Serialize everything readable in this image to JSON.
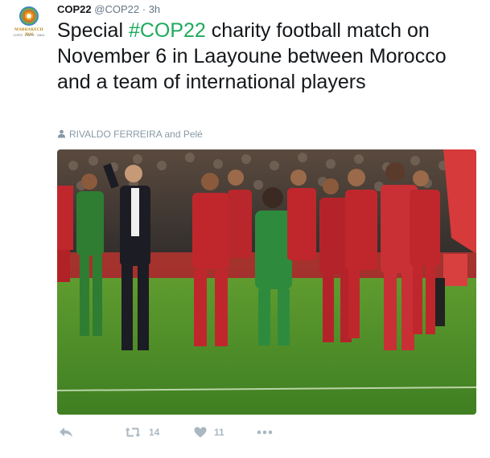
{
  "tweet": {
    "account_name": "COP22",
    "handle": "@COP22",
    "separator": "·",
    "time": "3h",
    "text_before": "Special ",
    "hashtag": "#COP22",
    "text_after": " charity football match on November 6 in Laayoune between Morocco and a team of international players",
    "tagged_people": "RIVALDO FERREIRA and Pelé",
    "avatar_logo_text": "MARRAKECH 2016",
    "avatar_logo_subtext": "COP22 · CMP12 · CMA1",
    "retweet_count": "14",
    "like_count": "11"
  },
  "icons": {
    "reply": "reply-icon",
    "retweet": "retweet-icon",
    "like": "heart-icon",
    "more": "more-icon",
    "tagged": "person-icon"
  },
  "colors": {
    "hashtag": "#1dab5c",
    "meta": "#657786",
    "action": "#aab8c2",
    "grass": "#4f8f2a",
    "morocco_red": "#c0272d",
    "morocco_green": "#2e7d32"
  }
}
